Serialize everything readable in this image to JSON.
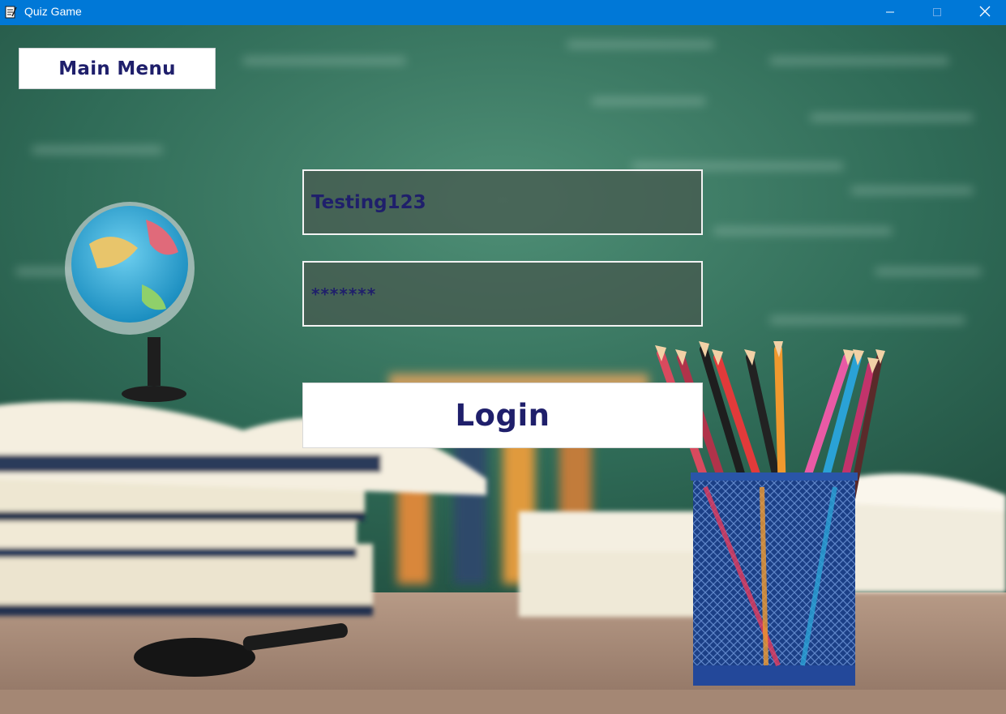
{
  "window": {
    "title": "Quiz Game",
    "app_icon": "notepad-icon",
    "controls": [
      "minimize-icon",
      "maximize-icon",
      "close-icon"
    ],
    "titlebar_color": "#0078d7"
  },
  "nav": {
    "main_menu_label": "Main Menu"
  },
  "login_form": {
    "username_value": "Testing123",
    "password_value": "*******",
    "login_label": "Login"
  },
  "colors": {
    "text_accent": "#1f1f6b",
    "chalkboard": "#2f6b57"
  }
}
